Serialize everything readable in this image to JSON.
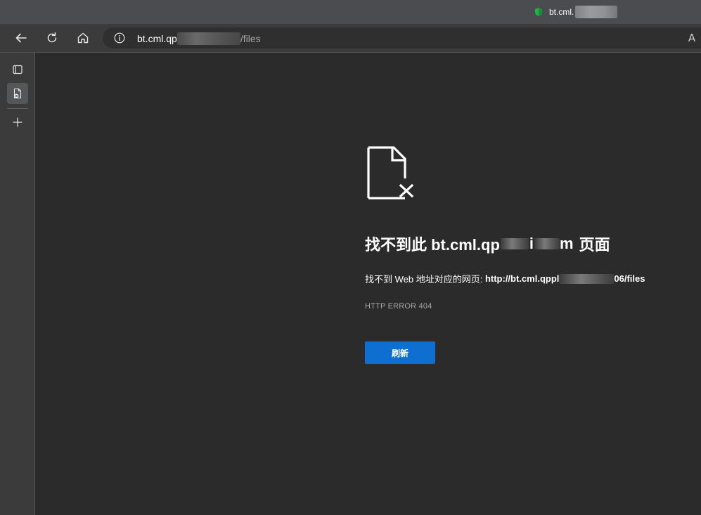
{
  "tab": {
    "title": "bt.cml.",
    "favicon": "shield-favicon-icon",
    "favicon_color": "#1fb34a"
  },
  "toolbar": {
    "back_icon": "back-arrow-icon",
    "refresh_icon": "refresh-icon",
    "home_icon": "home-icon",
    "info_icon": "info-icon",
    "read_aloud_icon": "read-aloud-icon",
    "read_aloud_label": "A",
    "address": {
      "host_visible": "bt.cml.qp",
      "path": "/files"
    }
  },
  "sidebar": {
    "items": [
      {
        "icon": "tab-actions-icon"
      },
      {
        "icon": "error-page-tab-icon",
        "active": true
      },
      {
        "icon": "plus-icon"
      }
    ]
  },
  "error_page": {
    "icon": "file-not-found-icon",
    "title_prefix": "找不到此 bt.cml.qp",
    "title_fragment_1": "i",
    "title_fragment_2": "m",
    "title_suffix": "页面",
    "description_prefix": "找不到 Web 地址对应的网页: ",
    "url_visible_start": "http://bt.cml.qppl",
    "url_visible_end": "06/files",
    "error_code": "HTTP ERROR 404",
    "refresh_button_label": "刷新",
    "accent_color": "#0f6fd0"
  }
}
